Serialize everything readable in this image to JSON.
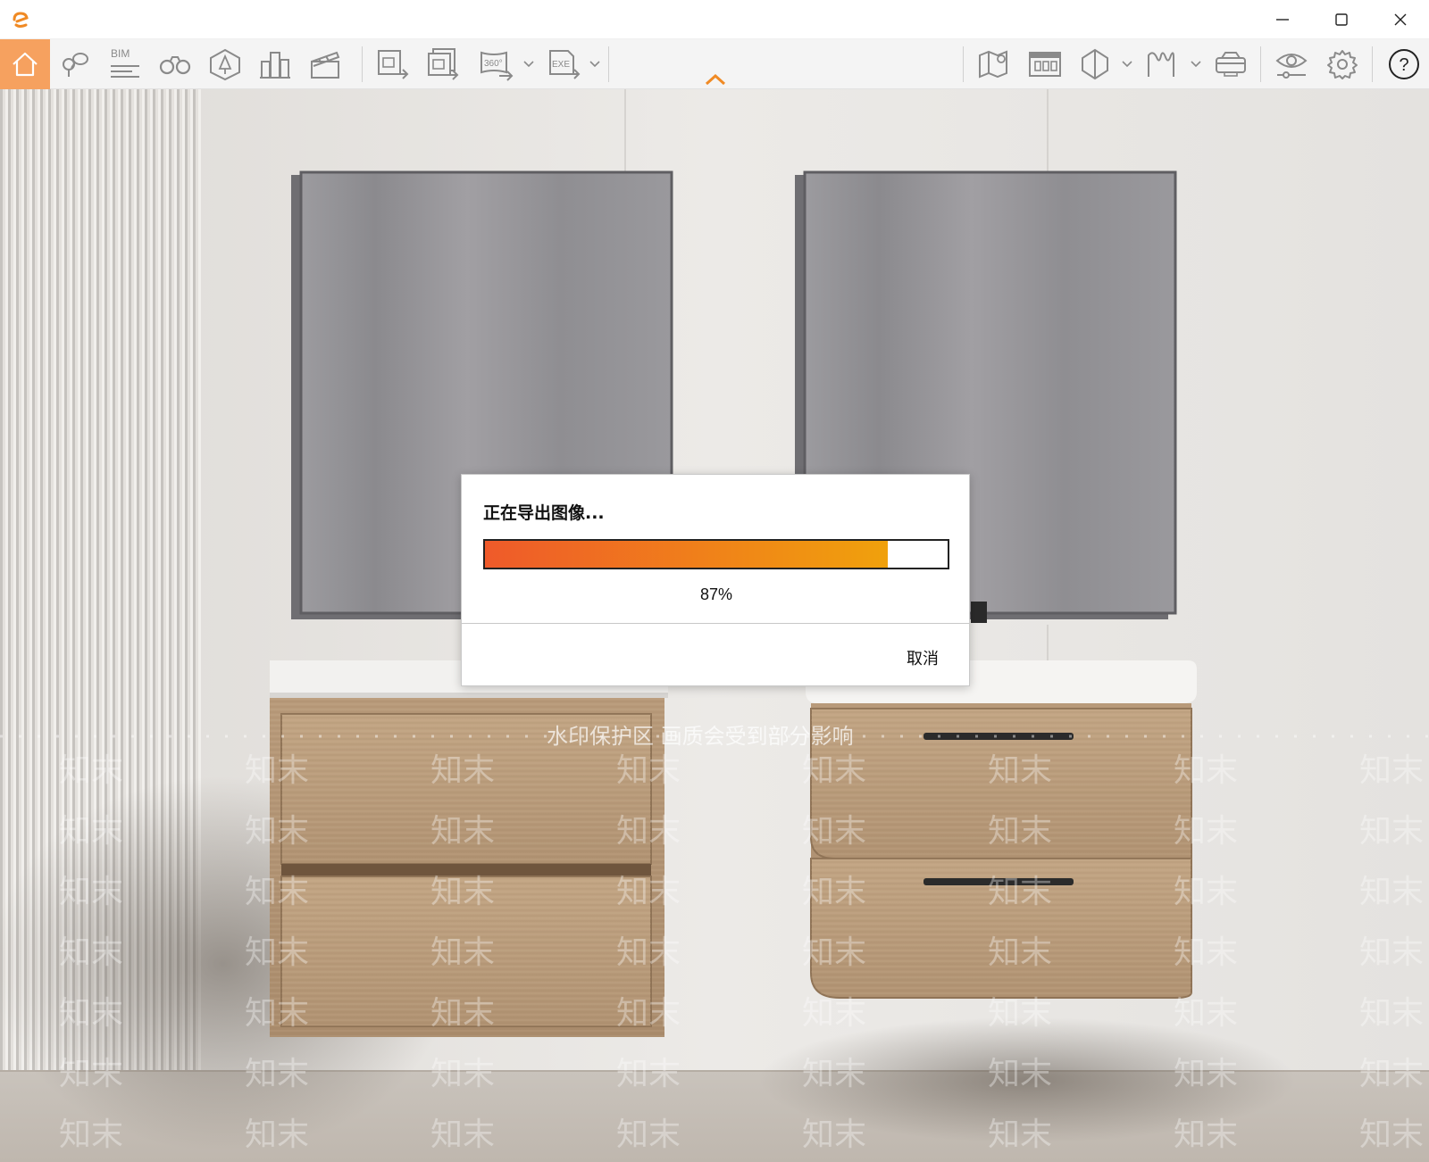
{
  "app": {
    "logo_icon": "enscape-logo-icon",
    "accent_color": "#f08a24"
  },
  "window_controls": {
    "minimize_icon": "minimize-icon",
    "maximize_icon": "maximize-icon",
    "close_icon": "close-icon"
  },
  "toolbar": {
    "bim_label": "BIM",
    "pano_label": "360°",
    "exe_label": "EXE",
    "help_label": "?",
    "left_tools": [
      "home-icon",
      "location-pins-icon",
      "bim-info-icon",
      "binoculars-icon",
      "site-context-icon",
      "buildings-icon",
      "clapperboard-icon",
      "export-image-icon",
      "batch-export-icon",
      "panorama-export-icon",
      "exe-export-icon"
    ],
    "right_tools": [
      "map-icon",
      "asset-library-icon",
      "section-box-icon",
      "atmosphere-icon",
      "vr-headset-icon",
      "visual-settings-icon",
      "settings-icon",
      "help-icon"
    ]
  },
  "watermark": {
    "banner": "水印保护区  画质会受到部分影响",
    "tiles": [
      "知末",
      "知末",
      "知末",
      "知末",
      "知末",
      "知末",
      "知末",
      "知末",
      "知末",
      "知末",
      "知末",
      "知末",
      "知末",
      "知末",
      "知末",
      "知末",
      "知末",
      "知末",
      "知末",
      "知末",
      "知末",
      "知末",
      "知末",
      "知末",
      "知末",
      "知末",
      "知末",
      "知末",
      "知末",
      "知末",
      "知末",
      "知末",
      "知末",
      "知末",
      "知末",
      "知末",
      "知末",
      "知末",
      "知末",
      "知末",
      "知末",
      "知末",
      "知末",
      "知末",
      "知末",
      "知末",
      "知末",
      "知末",
      "知末",
      "知末",
      "知末",
      "知末",
      "知末",
      "知末",
      "知末",
      "知末"
    ]
  },
  "dialog": {
    "title": "正在导出图像...",
    "progress": 0.87,
    "progress_text": "87%",
    "cancel_label": "取消",
    "progress_start_color": "#ef5a2a",
    "progress_end_color": "#f0a10c"
  }
}
